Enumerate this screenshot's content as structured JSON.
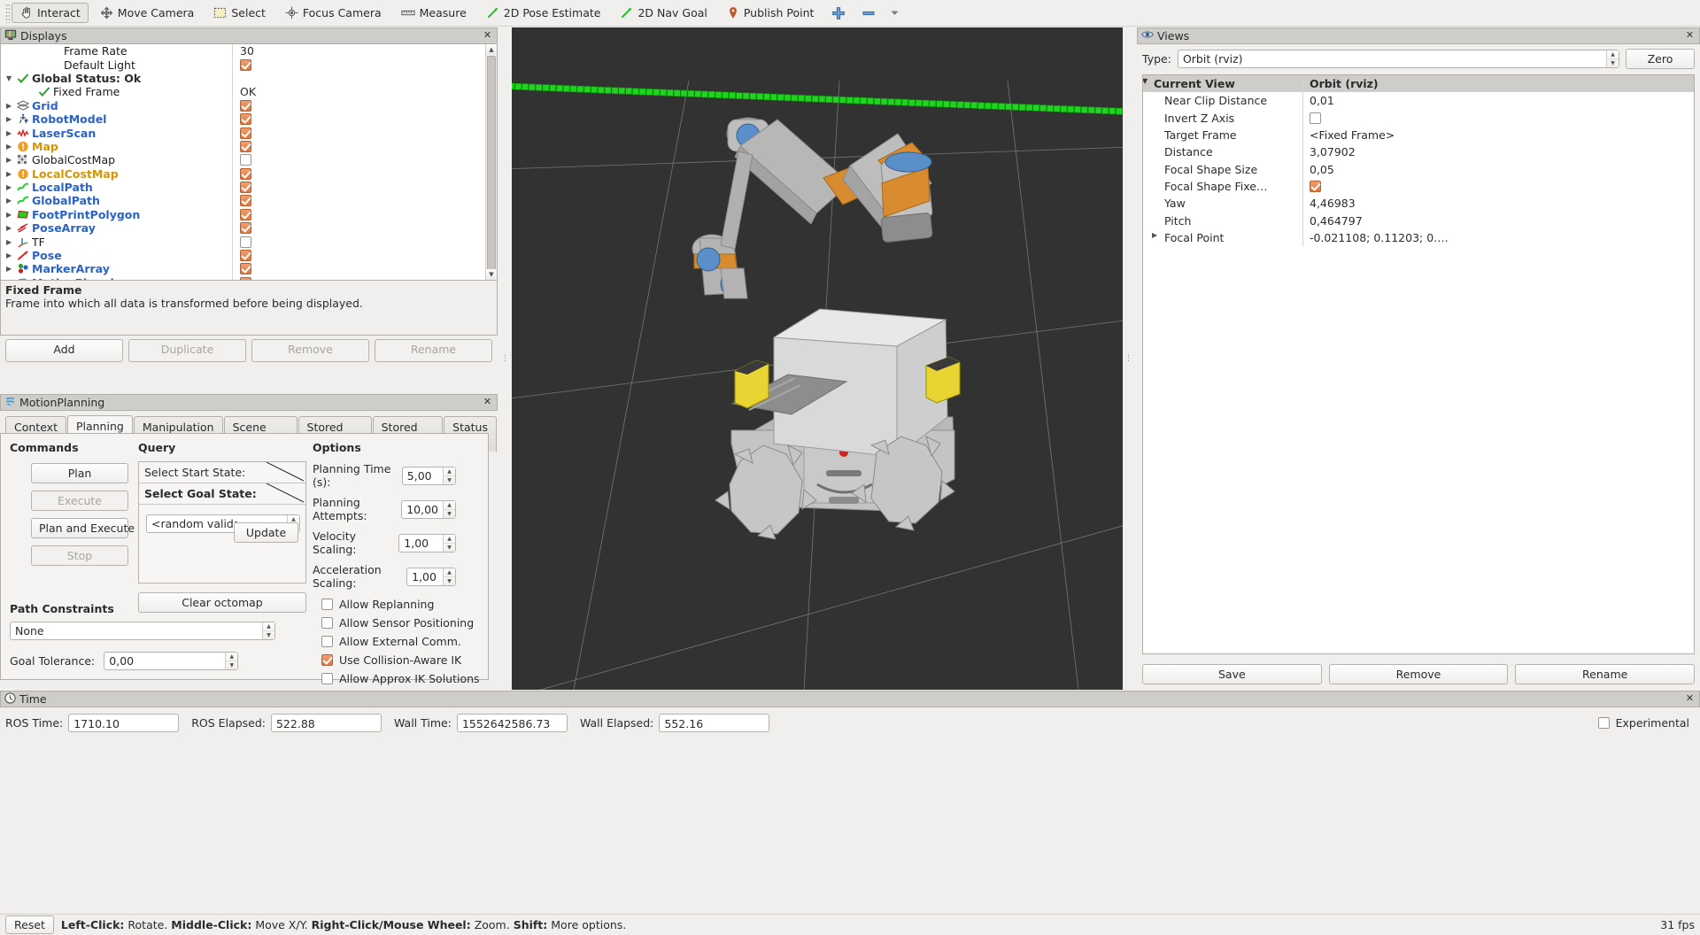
{
  "toolbar": {
    "items": [
      {
        "label": "Interact",
        "icon": "hand-icon",
        "active": true
      },
      {
        "label": "Move Camera",
        "icon": "move-camera-icon",
        "active": false
      },
      {
        "label": "Select",
        "icon": "select-icon",
        "active": false
      },
      {
        "label": "Focus Camera",
        "icon": "focus-camera-icon",
        "active": false
      },
      {
        "label": "Measure",
        "icon": "measure-icon",
        "active": false
      },
      {
        "label": "2D Pose Estimate",
        "icon": "pose-estimate-icon",
        "active": false
      },
      {
        "label": "2D Nav Goal",
        "icon": "nav-goal-icon",
        "active": false
      },
      {
        "label": "Publish Point",
        "icon": "publish-point-icon",
        "active": false
      }
    ],
    "add_tool_icon": "plus-icon",
    "remove_tool_icon": "minus-icon",
    "overflow_icon": "chevron-down-icon"
  },
  "displays": {
    "title": "Displays",
    "close_label": "✕",
    "rows": [
      {
        "name": "Frame Rate",
        "value": "30",
        "kind": "text",
        "style": "plain",
        "indent": 2,
        "arrow": "",
        "icon": ""
      },
      {
        "name": "Default Light",
        "value": "",
        "kind": "check",
        "checked": true,
        "style": "plain",
        "indent": 2,
        "arrow": "",
        "icon": ""
      },
      {
        "name": "Global Status: Ok",
        "value": "",
        "kind": "none",
        "style": "bold",
        "indent": 0,
        "arrow": "▼",
        "icon": "check-icon"
      },
      {
        "name": "Fixed Frame",
        "value": "OK",
        "kind": "text",
        "style": "plain",
        "indent": 1,
        "arrow": "",
        "icon": "check-icon"
      },
      {
        "name": "Grid",
        "value": "",
        "kind": "check",
        "checked": true,
        "style": "blue",
        "indent": 0,
        "arrow": "▶",
        "icon": "grid-icon"
      },
      {
        "name": "RobotModel",
        "value": "",
        "kind": "check",
        "checked": true,
        "style": "blue",
        "indent": 0,
        "arrow": "▶",
        "icon": "robot-icon"
      },
      {
        "name": "LaserScan",
        "value": "",
        "kind": "check",
        "checked": true,
        "style": "blue",
        "indent": 0,
        "arrow": "▶",
        "icon": "laserscan-icon"
      },
      {
        "name": "Map",
        "value": "",
        "kind": "check",
        "checked": true,
        "style": "orange",
        "indent": 0,
        "arrow": "▶",
        "icon": "warning-icon"
      },
      {
        "name": "GlobalCostMap",
        "value": "",
        "kind": "check",
        "checked": false,
        "style": "plain",
        "indent": 0,
        "arrow": "▶",
        "icon": "costmap-icon"
      },
      {
        "name": "LocalCostMap",
        "value": "",
        "kind": "check",
        "checked": true,
        "style": "orange",
        "indent": 0,
        "arrow": "▶",
        "icon": "warning-icon"
      },
      {
        "name": "LocalPath",
        "value": "",
        "kind": "check",
        "checked": true,
        "style": "blue",
        "indent": 0,
        "arrow": "▶",
        "icon": "path-icon"
      },
      {
        "name": "GlobalPath",
        "value": "",
        "kind": "check",
        "checked": true,
        "style": "blue",
        "indent": 0,
        "arrow": "▶",
        "icon": "path-icon"
      },
      {
        "name": "FootPrintPolygon",
        "value": "",
        "kind": "check",
        "checked": true,
        "style": "blue",
        "indent": 0,
        "arrow": "▶",
        "icon": "polygon-icon"
      },
      {
        "name": "PoseArray",
        "value": "",
        "kind": "check",
        "checked": true,
        "style": "blue",
        "indent": 0,
        "arrow": "▶",
        "icon": "posearray-icon"
      },
      {
        "name": "TF",
        "value": "",
        "kind": "check",
        "checked": false,
        "style": "plain",
        "indent": 0,
        "arrow": "▶",
        "icon": "tf-icon"
      },
      {
        "name": "Pose",
        "value": "",
        "kind": "check",
        "checked": true,
        "style": "blue",
        "indent": 0,
        "arrow": "▶",
        "icon": "pose-icon"
      },
      {
        "name": "MarkerArray",
        "value": "",
        "kind": "check",
        "checked": true,
        "style": "blue",
        "indent": 0,
        "arrow": "▶",
        "icon": "markerarray-icon"
      },
      {
        "name": "MotionPlanning",
        "value": "",
        "kind": "check",
        "checked": true,
        "style": "blue",
        "indent": 0,
        "arrow": "▶",
        "icon": "motionplanning-icon"
      }
    ],
    "description": {
      "title": "Fixed Frame",
      "text": "Frame into which all data is transformed before being displayed."
    },
    "buttons": [
      {
        "label": "Add",
        "enabled": true
      },
      {
        "label": "Duplicate",
        "enabled": false
      },
      {
        "label": "Remove",
        "enabled": false
      },
      {
        "label": "Rename",
        "enabled": false
      }
    ]
  },
  "motion_planning": {
    "title": "MotionPlanning",
    "close_label": "✕",
    "tabs": [
      {
        "label": "Context",
        "selected": false
      },
      {
        "label": "Planning",
        "selected": true
      },
      {
        "label": "Manipulation",
        "selected": false
      },
      {
        "label": "Scene Objects",
        "selected": false
      },
      {
        "label": "Stored Scenes",
        "selected": false
      },
      {
        "label": "Stored States",
        "selected": false
      },
      {
        "label": "Status",
        "selected": false
      }
    ],
    "commands": {
      "heading": "Commands",
      "buttons": [
        {
          "label": "Plan",
          "enabled": true
        },
        {
          "label": "Execute",
          "enabled": false
        },
        {
          "label": "Plan and Execute",
          "enabled": true
        },
        {
          "label": "Stop",
          "enabled": false
        }
      ]
    },
    "query": {
      "heading": "Query",
      "start_state_label": "Select Start State:",
      "goal_state_label": "Select Goal State:",
      "goal_combo_value": "<random valid>",
      "update_label": "Update",
      "clear_octomap_label": "Clear octomap"
    },
    "options": {
      "heading": "Options",
      "fields": [
        {
          "label": "Planning Time (s):",
          "value": "5,00"
        },
        {
          "label": "Planning Attempts:",
          "value": "10,00"
        },
        {
          "label": "Velocity Scaling:",
          "value": "1,00"
        },
        {
          "label": "Acceleration Scaling:",
          "value": "1,00"
        }
      ],
      "checkboxes": [
        {
          "label": "Allow Replanning",
          "checked": false
        },
        {
          "label": "Allow Sensor Positioning",
          "checked": false
        },
        {
          "label": "Allow External Comm.",
          "checked": false
        },
        {
          "label": "Use Collision-Aware IK",
          "checked": true
        },
        {
          "label": "Allow Approx IK Solutions",
          "checked": false
        }
      ]
    },
    "path_constraints": {
      "heading": "Path Constraints",
      "combo_value": "None",
      "goal_tolerance_label": "Goal Tolerance:",
      "goal_tolerance_value": "0,00"
    }
  },
  "views": {
    "title": "Views",
    "close_label": "✕",
    "type_label": "Type:",
    "type_value": "Orbit (rviz)",
    "zero_label": "Zero",
    "header": {
      "key": "Current View",
      "value": "Orbit (rviz)"
    },
    "rows": [
      {
        "key": "Near Clip Distance",
        "value": "0,01",
        "kind": "text"
      },
      {
        "key": "Invert Z Axis",
        "value": "",
        "kind": "check",
        "checked": false
      },
      {
        "key": "Target Frame",
        "value": "<Fixed Frame>",
        "kind": "text"
      },
      {
        "key": "Distance",
        "value": "3,07902",
        "kind": "text"
      },
      {
        "key": "Focal Shape Size",
        "value": "0,05",
        "kind": "text"
      },
      {
        "key": "Focal Shape Fixe…",
        "value": "",
        "kind": "check",
        "checked": true
      },
      {
        "key": "Yaw",
        "value": "4,46983",
        "kind": "text"
      },
      {
        "key": "Pitch",
        "value": "0,464797",
        "kind": "text"
      },
      {
        "key": "Focal Point",
        "value": "-0.021108; 0.11203; 0….",
        "kind": "text",
        "arrow": "▶"
      }
    ],
    "buttons": [
      {
        "label": "Save"
      },
      {
        "label": "Remove"
      },
      {
        "label": "Rename"
      }
    ]
  },
  "time": {
    "title": "Time",
    "close_label": "✕",
    "fields": [
      {
        "label": "ROS Time:",
        "value": "1710.10"
      },
      {
        "label": "ROS Elapsed:",
        "value": "522.88"
      },
      {
        "label": "Wall Time:",
        "value": "1552642586.73"
      },
      {
        "label": "Wall Elapsed:",
        "value": "552.16"
      }
    ],
    "experimental_label": "Experimental",
    "experimental_checked": false
  },
  "status_bar": {
    "reset_label": "Reset",
    "hint_segments": [
      {
        "text": "Left-Click:",
        "bold": true
      },
      {
        "text": " Rotate. ",
        "bold": false
      },
      {
        "text": "Middle-Click:",
        "bold": true
      },
      {
        "text": " Move X/Y. ",
        "bold": false
      },
      {
        "text": "Right-Click/Mouse Wheel:",
        "bold": true
      },
      {
        "text": " Zoom. ",
        "bold": false
      },
      {
        "text": "Shift:",
        "bold": true
      },
      {
        "text": " More options.",
        "bold": false
      }
    ],
    "fps": "31 fps"
  },
  "colors": {
    "accent_orange": "#e2763c",
    "link_blue": "#2a63c8",
    "warn_orange": "#d79600",
    "viewport_bg": "#323232",
    "marker_green": "#22dd22"
  }
}
